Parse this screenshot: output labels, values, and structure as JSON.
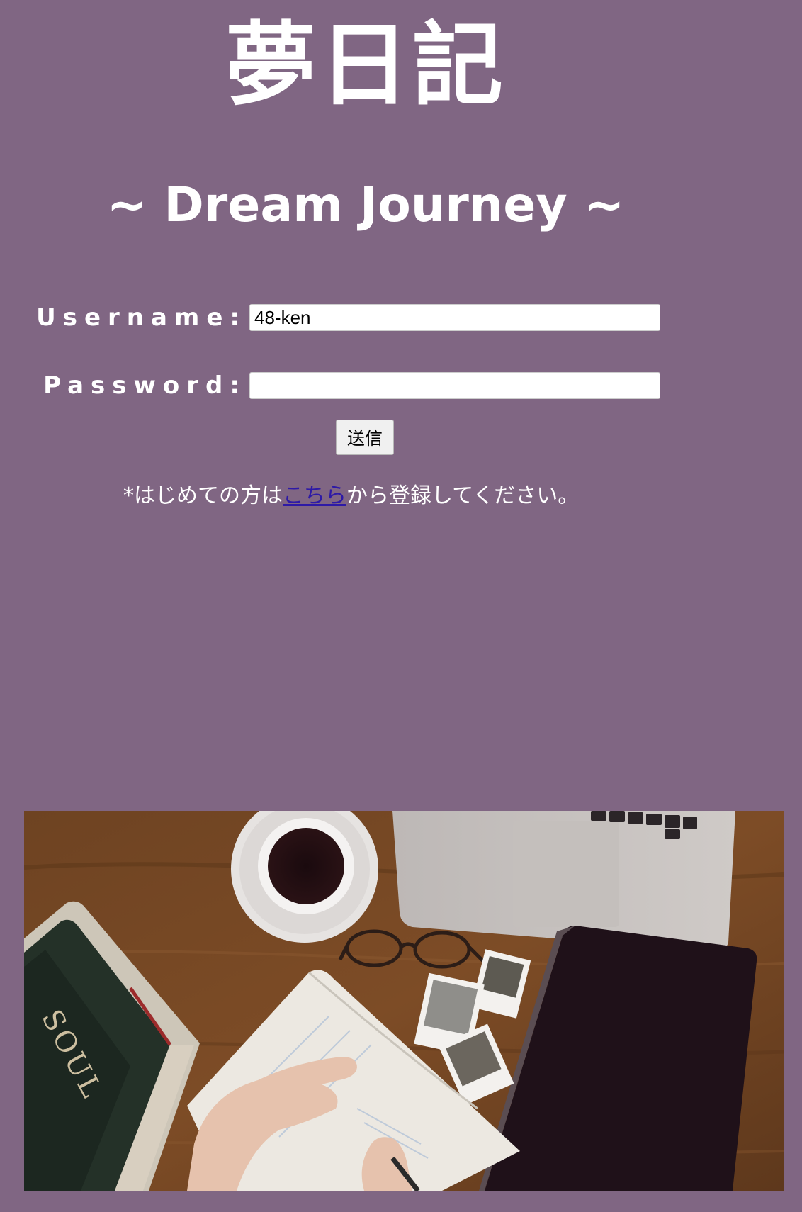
{
  "page": {
    "title": "夢日記",
    "subtitle": "~ Dream Journey ~"
  },
  "login_form": {
    "username_label": "Username:",
    "username_value": "48-ken",
    "password_label": "Password:",
    "password_value": "",
    "submit_label": "送信"
  },
  "note": {
    "prefix": "*はじめての方は",
    "link_text": "こちら",
    "suffix": "から登録してください。"
  },
  "photo": {
    "book_text": "SOUL"
  },
  "colors": {
    "background": "#806683",
    "text": "#ffffff",
    "link": "#2e1aa6"
  }
}
